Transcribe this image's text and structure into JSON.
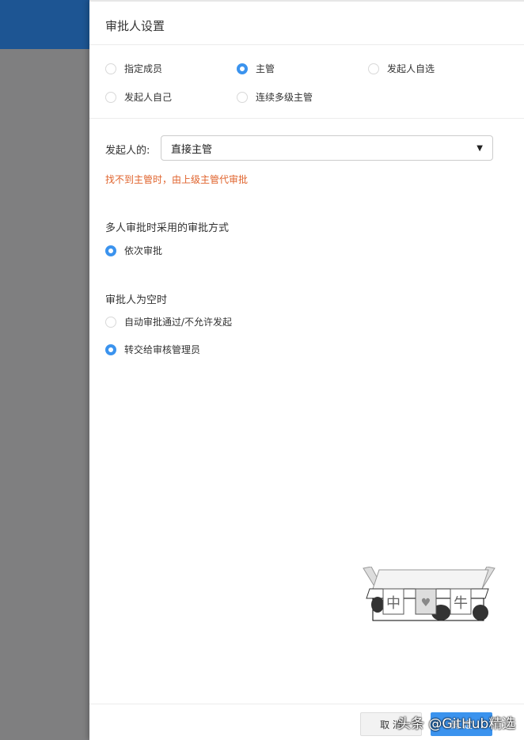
{
  "panel": {
    "title": "审批人设置"
  },
  "approver_types": [
    {
      "label": "指定成员",
      "checked": false
    },
    {
      "label": "主管",
      "checked": true
    },
    {
      "label": "发起人自选",
      "checked": false
    },
    {
      "label": "发起人自己",
      "checked": false
    },
    {
      "label": "连续多级主管",
      "checked": false
    }
  ],
  "supervisor": {
    "label": "发起人的:",
    "value": "直接主管",
    "warning": "找不到主管时，由上级主管代审批"
  },
  "multi": {
    "heading": "多人审批时采用的审批方式",
    "options": [
      {
        "label": "依次审批",
        "checked": true
      }
    ]
  },
  "empty": {
    "heading": "审批人为空时",
    "options": [
      {
        "label": "自动审批通过/不允许发起",
        "checked": false
      },
      {
        "label": "转交给审核管理员",
        "checked": true
      }
    ]
  },
  "footer": {
    "cancel": "取 消",
    "confirm": "确 定"
  },
  "watermark": "头条 @GitHub精选",
  "colors": {
    "accent": "#3b93ee",
    "warning": "#e0632c"
  }
}
